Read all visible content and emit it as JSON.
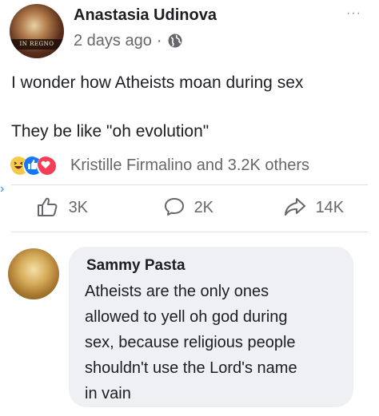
{
  "post": {
    "author": "Anastasia Udinova",
    "time": "2 days ago",
    "separator": "·",
    "more": "···",
    "avatar_banner": "IN REGNO",
    "text_line1": "I wonder how Atheists moan during sex",
    "text_line2": "They be like \"oh evolution\""
  },
  "reactions": {
    "icons": [
      "haha-icon",
      "like-icon",
      "love-icon"
    ],
    "text": "Kristille Firmalino and 3.2K others"
  },
  "actions": {
    "like_count": "3K",
    "comment_count": "2K",
    "share_count": "14K"
  },
  "comment": {
    "author": "Sammy Pasta",
    "lines": [
      "Atheists are the only ones",
      "allowed to yell oh god during",
      "sex, because religious people",
      "shouldn't use the Lord's name",
      "in vain"
    ]
  },
  "colors": {
    "meta_gray": "#65676b",
    "like_blue": "#1877f2",
    "love_red": "#f33e58",
    "haha_yellow": "#f7c948",
    "bubble_bg": "#eef0f3"
  }
}
